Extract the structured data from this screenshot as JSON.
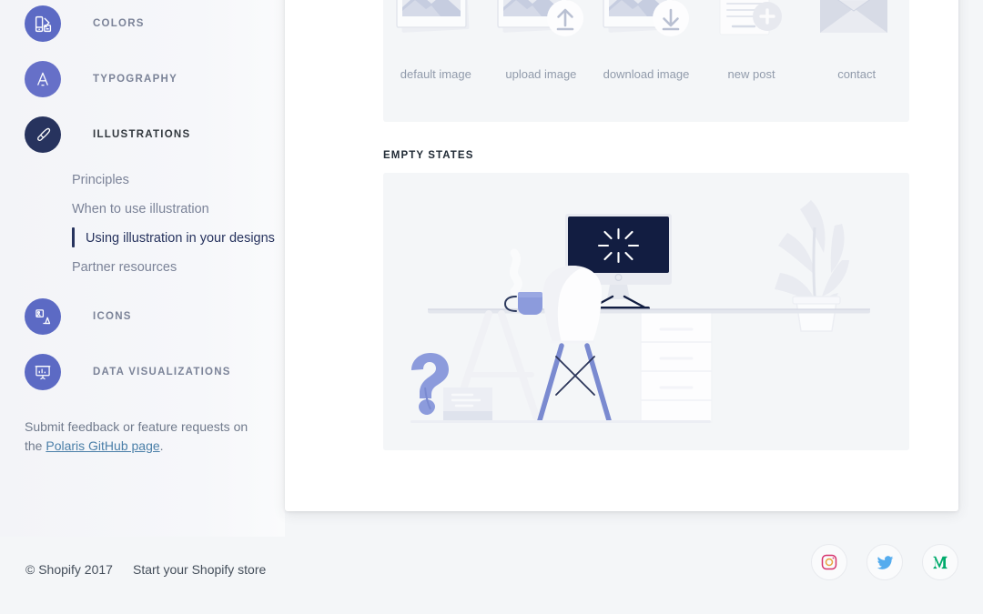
{
  "sidebar": {
    "sections": [
      {
        "id": "colors",
        "label": "COLORS",
        "icon": "palette-icon",
        "active": false,
        "circle_color": "#5c6ac4"
      },
      {
        "id": "typography",
        "label": "TYPOGRAPHY",
        "icon": "letter-a-icon",
        "active": false,
        "circle_color": "#6670c8"
      },
      {
        "id": "illustrations",
        "label": "ILLUSTRATIONS",
        "icon": "paintbrush-icon",
        "active": true,
        "circle_color": "#27335e"
      },
      {
        "id": "icons",
        "label": "ICONS",
        "icon": "image-shapes-icon",
        "active": false,
        "circle_color": "#5c6ac4"
      },
      {
        "id": "data-visualizations",
        "label": "DATA VISUALIZATIONS",
        "icon": "bar-chart-board-icon",
        "active": false,
        "circle_color": "#5c6ac4"
      }
    ],
    "sub_items": [
      {
        "label": "Principles",
        "active": false
      },
      {
        "label": "When to use illustration",
        "active": false
      },
      {
        "label": "Using illustration in your designs",
        "active": true
      },
      {
        "label": "Partner resources",
        "active": false
      }
    ],
    "feedback": {
      "text_before": "Submit feedback or feature requests on the ",
      "link": "Polaris GitHub page",
      "text_after": "."
    }
  },
  "main": {
    "section_heading": "EMPTY STATES",
    "illustration_thumbs": [
      {
        "label": "default image",
        "icon": "photo-stack-icon"
      },
      {
        "label": "upload image",
        "icon": "photo-stack-upload-icon"
      },
      {
        "label": "download image",
        "icon": "photo-stack-download-icon"
      },
      {
        "label": "new post",
        "icon": "document-plus-icon"
      },
      {
        "label": "contact",
        "icon": "open-envelope-icon"
      }
    ],
    "empty_state_illustration": {
      "name": "desk-workspace-illustration",
      "elements": [
        "monitor",
        "starburst-screen-icon",
        "chair",
        "desk",
        "coffee-mug",
        "plant",
        "filing-cabinet",
        "question-mark"
      ],
      "monitor_color": "#121d41",
      "accent_color": "#8c9bdc"
    }
  },
  "footer": {
    "copyright": "© Shopify 2017",
    "store_link": "Start your Shopify store",
    "social": [
      {
        "name": "instagram-icon",
        "color": "#e1306c"
      },
      {
        "name": "twitter-icon",
        "color": "#55acee"
      },
      {
        "name": "medium-icon",
        "color": "#00ab6c"
      }
    ]
  }
}
